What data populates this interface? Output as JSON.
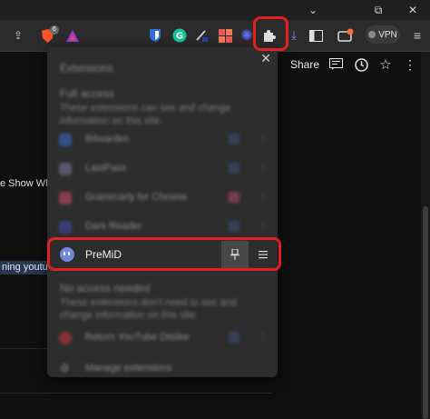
{
  "window": {
    "minimize_glyph": "⌄",
    "restore_glyph": "⧉",
    "close_glyph": "✕"
  },
  "toolbar": {
    "vpn_label": "VPN",
    "brave_badge": "6",
    "icons": [
      "share-icon",
      "brave-shields-icon",
      "brave-rewards-icon",
      "bitwarden-icon",
      "grammarly-icon",
      "pen-icon",
      "grid-icon",
      "gear-icon",
      "puzzle-extensions-icon",
      "download-icon",
      "sidebar-icon",
      "wallet-icon"
    ]
  },
  "page": {
    "text_show": "e Show Wh",
    "text_highlight": "ning youtu"
  },
  "video_actions": {
    "share_label": "Share"
  },
  "extensions_popup": {
    "close_glyph": "✕",
    "title": "Extensions",
    "section_full_access": "Full access",
    "section_full_access_desc": "These extensions can see and change information on this site.",
    "rows_top": [
      {
        "name": "Bitwarden",
        "color": "#3b6fd6"
      },
      {
        "name": "LastPass",
        "color": "#7a7a9a"
      },
      {
        "name": "Grammarly for Chrome",
        "color": "#d04a6a"
      },
      {
        "name": "Dark Reader",
        "color": "#4a4ab0"
      }
    ],
    "premid": {
      "name": "PreMiD",
      "pin_glyph": "📌",
      "more_glyph": "⋮"
    },
    "section_no_access": "No access needed",
    "section_no_access_desc": "These extensions don't need to see and change information on this site.",
    "rows_bottom": [
      {
        "name": "Return YouTube Dislike",
        "color": "#d03535"
      }
    ],
    "manage_label": "Manage extensions"
  },
  "highlight_color": "#e0211d"
}
